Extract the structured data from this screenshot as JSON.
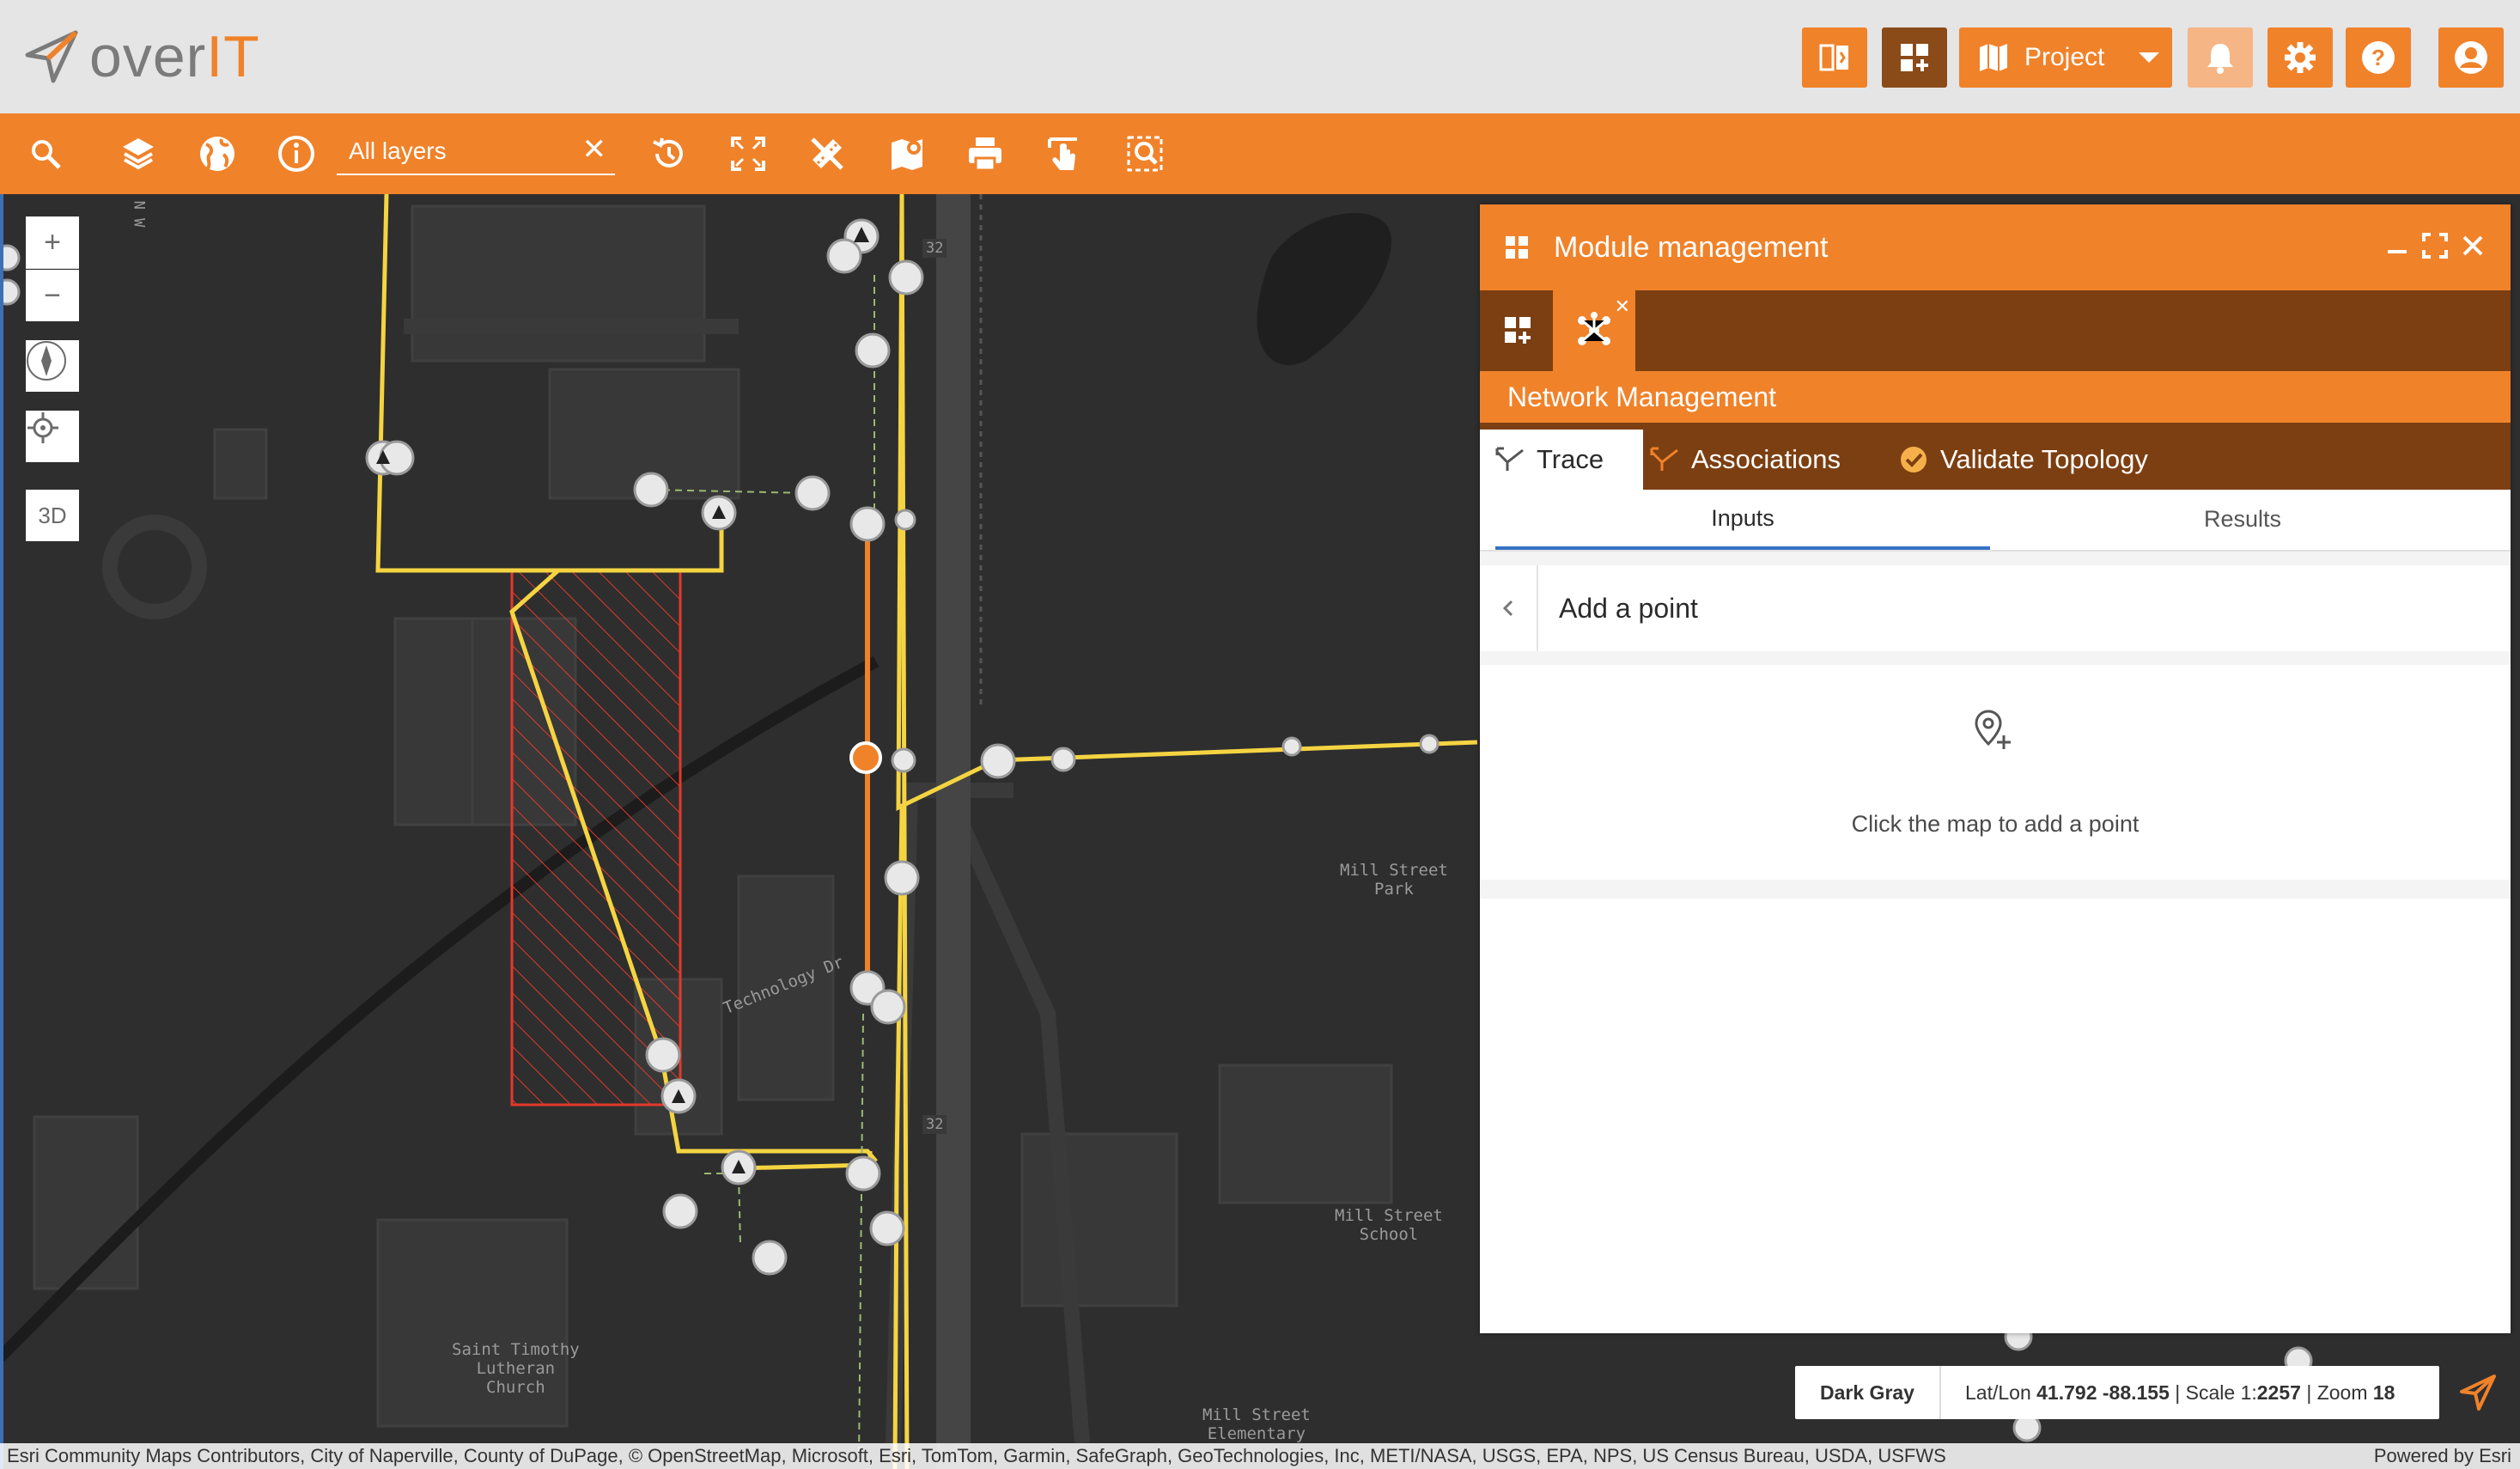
{
  "brand": {
    "prefix": "over",
    "suffix": "IT",
    "accent": "#f0822a",
    "dark_accent": "#7c3f12"
  },
  "header": {
    "project_label": "Project",
    "icons": [
      "split-view-icon",
      "add-module-icon",
      "map-icon",
      "bell-icon",
      "gear-icon",
      "help-icon",
      "user-icon"
    ]
  },
  "toolbar": {
    "layers_value": "All layers",
    "tools": [
      "search-icon",
      "layers-icon",
      "globe-icon",
      "info-icon",
      "history-icon",
      "fullscreen-icon",
      "measure-icon",
      "map-edit-icon",
      "print-icon",
      "touch-icon",
      "select-zoom-icon"
    ]
  },
  "map": {
    "controls": {
      "zoom_in": "+",
      "zoom_out": "−",
      "mode_3d": "3D"
    },
    "labels": {
      "road": "Technology Dr",
      "park": "Mill Street\nPark",
      "school": "Mill Street\nSchool",
      "church": "Saint Timothy\nLutheran\nChurch",
      "elementary": "Mill Street\nElementary",
      "route_1": "32",
      "route_2": "32",
      "side_road": "N W"
    }
  },
  "panel": {
    "title": "Module management",
    "module_name": "Network Management",
    "tabs": [
      {
        "label": "Trace",
        "icon": "trace-icon"
      },
      {
        "label": "Associations",
        "icon": "associations-icon"
      },
      {
        "label": "Validate Topology",
        "icon": "check-circle-icon"
      }
    ],
    "subtabs": [
      "Inputs",
      "Results"
    ],
    "step_title": "Add a point",
    "step_hint": "Click the map to add a point"
  },
  "status": {
    "basemap": "Dark Gray",
    "latlon_label": "Lat/Lon",
    "latlon": "41.792 -88.155",
    "scale_label": "| Scale 1:",
    "scale": "2257",
    "zoom_label": "| Zoom",
    "zoom": "18"
  },
  "attribution": {
    "text": "Esri Community Maps Contributors, City of Naperville, County of DuPage, © OpenStreetMap, Microsoft, Esri, TomTom, Garmin, SafeGraph, GeoTechnologies, Inc, METI/NASA, USGS, EPA, NPS, US Census Bureau, USDA, USFWS",
    "powered": "Powered by Esri"
  }
}
